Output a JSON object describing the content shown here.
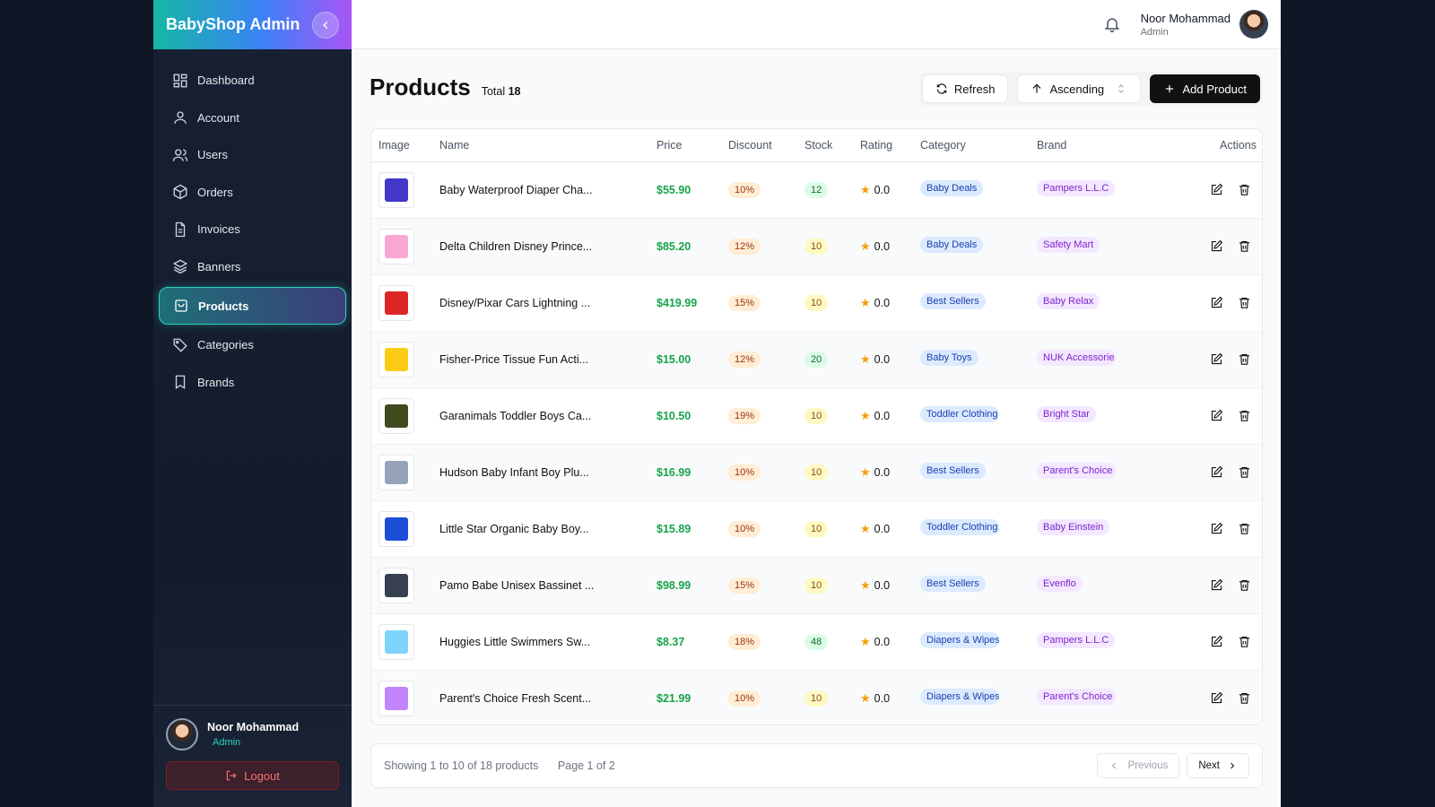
{
  "sidebar": {
    "brand": "BabyShop Admin",
    "items": [
      {
        "label": "Dashboard",
        "icon": "dashboard-icon"
      },
      {
        "label": "Account",
        "icon": "user-icon"
      },
      {
        "label": "Users",
        "icon": "users-icon"
      },
      {
        "label": "Orders",
        "icon": "package-icon"
      },
      {
        "label": "Invoices",
        "icon": "file-icon"
      },
      {
        "label": "Banners",
        "icon": "layers-icon"
      },
      {
        "label": "Products",
        "icon": "shopping-bag-icon",
        "active": true
      },
      {
        "label": "Categories",
        "icon": "tag-icon"
      },
      {
        "label": "Brands",
        "icon": "bookmark-icon"
      }
    ],
    "user": {
      "name": "Noor Mohammad",
      "role": "Admin"
    },
    "logout_label": "Logout"
  },
  "topbar": {
    "user_name": "Noor Mohammad",
    "user_role": "Admin"
  },
  "page": {
    "title": "Products",
    "total_label": "Total",
    "total_count": "18",
    "refresh_label": "Refresh",
    "sort_label": "Ascending",
    "add_label": "Add Product"
  },
  "table": {
    "headers": [
      "Image",
      "Name",
      "Price",
      "Discount",
      "Stock",
      "Rating",
      "Category",
      "Brand",
      "Actions"
    ],
    "rows": [
      {
        "name": "Baby Waterproof Diaper Cha...",
        "price": "$55.90",
        "discount": "10%",
        "stock": "12",
        "stock_high": true,
        "rating": "0.0",
        "category": "Baby Deals",
        "brand": "Pampers L.L.C",
        "img_color": "#4338ca"
      },
      {
        "name": "Delta Children Disney Prince...",
        "price": "$85.20",
        "discount": "12%",
        "stock": "10",
        "stock_high": false,
        "rating": "0.0",
        "category": "Baby Deals",
        "brand": "Safety Mart",
        "img_color": "#f9a8d4"
      },
      {
        "name": "Disney/Pixar Cars Lightning ...",
        "price": "$419.99",
        "discount": "15%",
        "stock": "10",
        "stock_high": false,
        "rating": "0.0",
        "category": "Best Sellers",
        "brand": "Baby Relax",
        "img_color": "#dc2626"
      },
      {
        "name": "Fisher-Price Tissue Fun Acti...",
        "price": "$15.00",
        "discount": "12%",
        "stock": "20",
        "stock_high": true,
        "rating": "0.0",
        "category": "Baby Toys",
        "brand": "NUK Accessorie",
        "img_color": "#facc15"
      },
      {
        "name": "Garanimals Toddler Boys Ca...",
        "price": "$10.50",
        "discount": "19%",
        "stock": "10",
        "stock_high": false,
        "rating": "0.0",
        "category": "Toddler Clothing",
        "brand": "Bright Star",
        "img_color": "#3f4a1f"
      },
      {
        "name": "Hudson Baby Infant Boy Plu...",
        "price": "$16.99",
        "discount": "10%",
        "stock": "10",
        "stock_high": false,
        "rating": "0.0",
        "category": "Best Sellers",
        "brand": "Parent's Choice",
        "img_color": "#94a3b8"
      },
      {
        "name": "Little Star Organic Baby Boy...",
        "price": "$15.89",
        "discount": "10%",
        "stock": "10",
        "stock_high": false,
        "rating": "0.0",
        "category": "Toddler Clothing",
        "brand": "Baby Einstein",
        "img_color": "#1d4ed8"
      },
      {
        "name": "Pamo Babe Unisex Bassinet ...",
        "price": "$98.99",
        "discount": "15%",
        "stock": "10",
        "stock_high": false,
        "rating": "0.0",
        "category": "Best Sellers",
        "brand": "Evenflo",
        "img_color": "#374151"
      },
      {
        "name": "Huggies Little Swimmers Sw...",
        "price": "$8.37",
        "discount": "18%",
        "stock": "48",
        "stock_high": true,
        "rating": "0.0",
        "category": "Diapers & Wipes",
        "brand": "Pampers L.L.C",
        "img_color": "#7dd3fc"
      },
      {
        "name": "Parent's Choice Fresh Scent...",
        "price": "$21.99",
        "discount": "10%",
        "stock": "10",
        "stock_high": false,
        "rating": "0.0",
        "category": "Diapers & Wipes",
        "brand": "Parent's Choice",
        "img_color": "#c084fc"
      }
    ]
  },
  "pagination": {
    "showing": "Showing 1 to 10 of 18 products",
    "page": "Page 1 of 2",
    "prev_label": "Previous",
    "next_label": "Next"
  }
}
